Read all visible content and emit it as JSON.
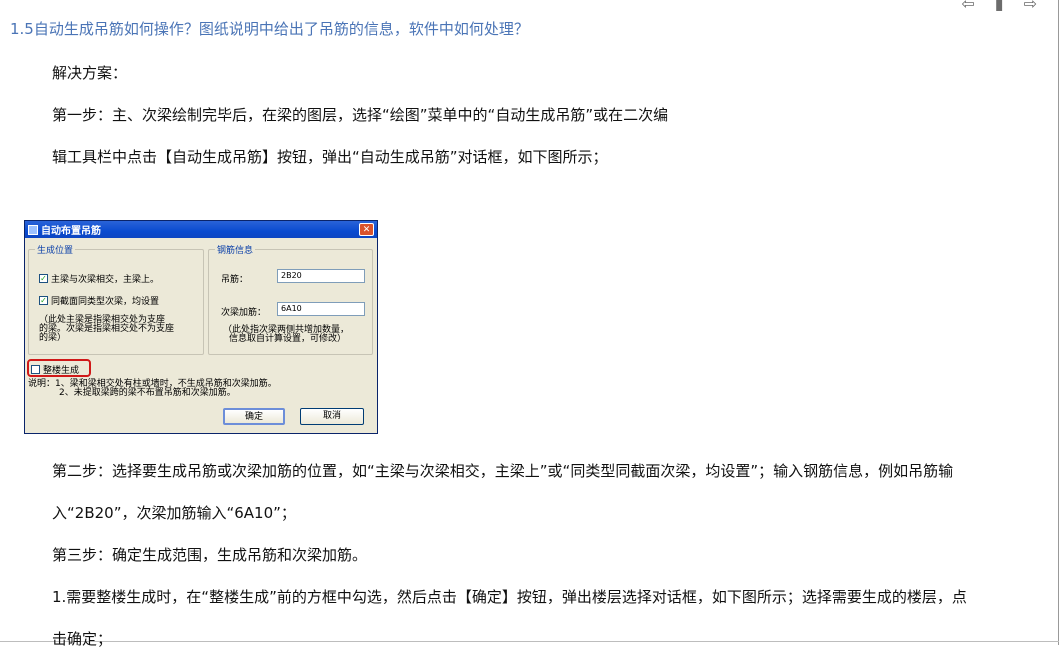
{
  "heading": "1.5自动生成吊筋如何操作？图纸说明中给出了吊筋的信息，软件中如何处理？",
  "paragraphs": {
    "solution": "解决方案：",
    "step1_line1": "第一步：主、次梁绘制完毕后，在梁的图层，选择“绘图”菜单中的“自动生成吊筋”或在二次编",
    "step1_line2": "辑工具栏中点击【自动生成吊筋】按钮，弹出“自动生成吊筋”对话框，如下图所示；",
    "step2_line1": "第二步：选择要生成吊筋或次梁加筋的位置，如“主梁与次梁相交，主梁上”或“同类型同截面次梁，均设置”；输入钢筋信息，例如吊筋输",
    "step2_line2": "入“2B20”，次梁加筋输入“6A10”；",
    "step3": "第三步：确定生成范围，生成吊筋和次梁加筋。",
    "item1_line1": "1.需要整楼生成时，在“整楼生成”前的方框中勾选，然后点击【确定】按钮，弹出楼层选择对话框，如下图所示；选择需要生成的楼层，点",
    "item1_line2": "击确定；"
  },
  "dialog": {
    "title": "自动布置吊筋",
    "close_glyph": "✕",
    "position_group": {
      "title": "生成位置",
      "option1": "主梁与次梁相交，主梁上。",
      "option1_checked": true,
      "option2": "同截面同类型次梁，均设置",
      "option2_checked": true,
      "note_line1": "（此处主梁是指梁相交处为支座",
      "note_line2": "的梁。次梁是指梁相交处不为支座",
      "note_line3": "的梁）"
    },
    "rebar_group": {
      "title": "钢筋信息",
      "hanger_label": "吊筋：",
      "hanger_value": "2B20",
      "secondary_label": "次梁加筋：",
      "secondary_value": "6A10",
      "note_line1": "（此处指次梁两侧共增加数量，",
      "note_line2": "信息取自计算设置，可修改）"
    },
    "whole_building": "整楼生成",
    "whole_building_checked": false,
    "remark_line1": "说明：1、梁和梁相交处有柱或墙时，不生成吊筋和次梁加筋。",
    "remark_line2": "2、未提取梁跨的梁不布置吊筋和次梁加筋。",
    "ok_label": "确定",
    "cancel_label": "取消"
  },
  "icons": {
    "check_glyph": "✓",
    "back_arrow": "⇦",
    "bookmark": "▮",
    "forward_arrow": "⇨"
  },
  "colors": {
    "heading": "#4a74b6",
    "highlight_box": "#d01818",
    "titlebar": "#0a4bd0"
  }
}
